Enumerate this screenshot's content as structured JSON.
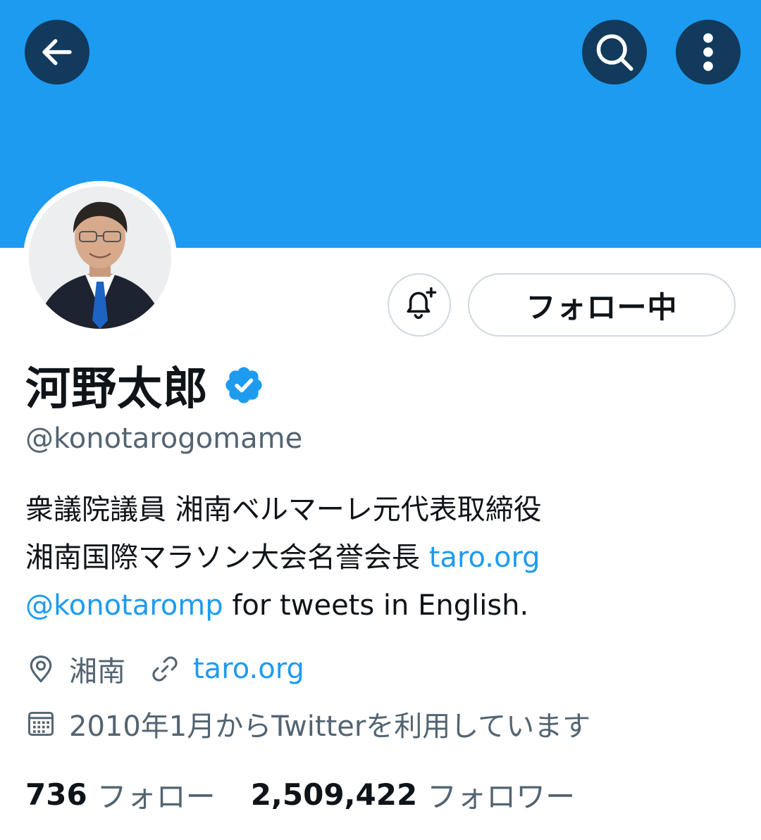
{
  "colors": {
    "banner": "#1d9bf0",
    "accent": "#1d9bf0",
    "header_button_bg": "#113a5c",
    "secondary_text": "#536471"
  },
  "header": {
    "back_icon": "arrow-left-icon",
    "search_icon": "search-icon",
    "more_icon": "more-vertical-icon"
  },
  "profile": {
    "avatar_icon": "avatar",
    "display_name": "河野太郎",
    "verified_icon": "verified-badge-icon",
    "handle": "@konotarogomame",
    "notify_icon": "bell-plus-icon",
    "follow_button_label": "フォロー中",
    "bio": {
      "line1": "衆議院議員 湘南ベルマーレ元代表取締役",
      "line2_text": "湘南国際マラソン大会名誉会長 ",
      "line2_link": "taro.org",
      "line3_link": "@konotaromp",
      "line3_text": " for tweets in English."
    },
    "location_icon": "location-pin-icon",
    "location": "湘南",
    "website_icon": "link-icon",
    "website": "taro.org",
    "joined_icon": "calendar-icon",
    "joined": "2010年1月からTwitterを利用しています"
  },
  "stats": {
    "following_count": "736",
    "following_label": "フォロー",
    "followers_count": "2,509,422",
    "followers_label": "フォロワー"
  }
}
